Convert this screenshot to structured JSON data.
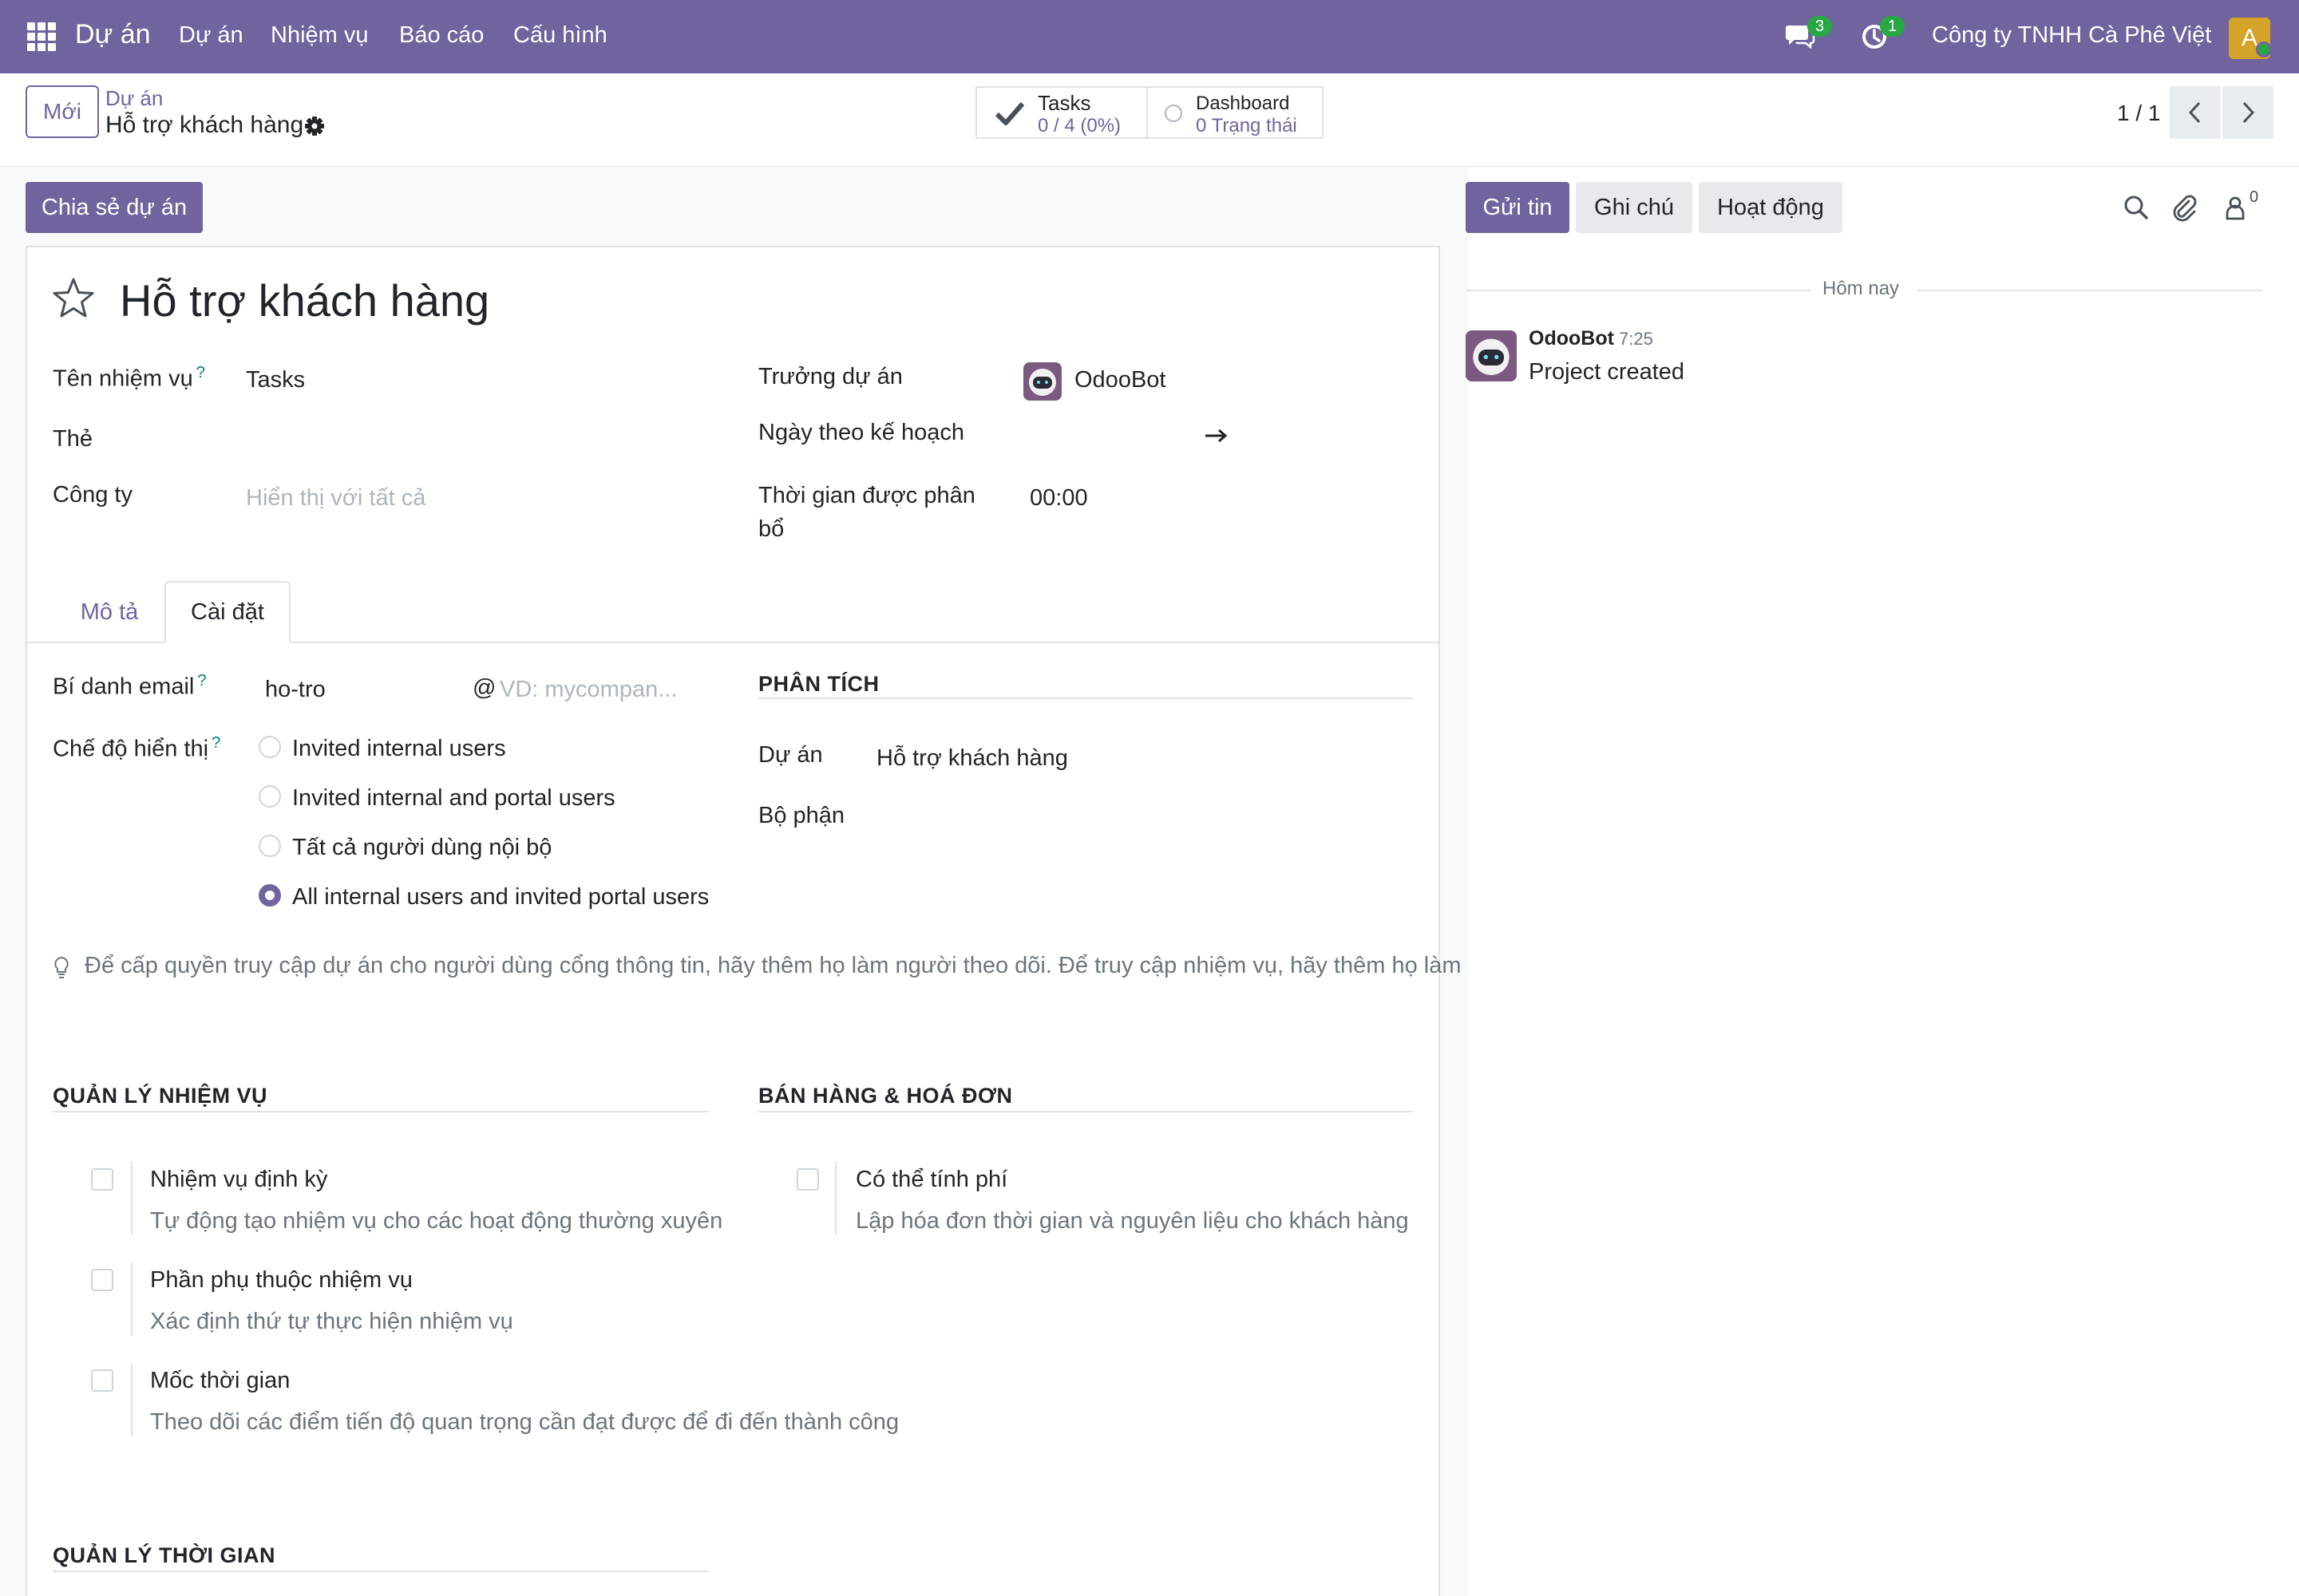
{
  "navbar": {
    "brand": "Dự án",
    "menu": [
      "Dự án",
      "Nhiệm vụ",
      "Báo cáo",
      "Cấu hình"
    ],
    "messages_count": "3",
    "activities_count": "1",
    "company": "Công ty TNHH Cà Phê Việt",
    "avatar_letter": "A"
  },
  "control": {
    "new_label": "Mới",
    "breadcrumb_parent": "Dự án",
    "breadcrumb_current": "Hỗ trợ khách hàng",
    "stats": {
      "tasks_title": "Tasks",
      "tasks_value": "0 / 4 (0%)",
      "dashboard_title": "Dashboard",
      "dashboard_value": "0 Trạng thái"
    },
    "pager": "1 / 1"
  },
  "form": {
    "share_label": "Chia sẻ dự án",
    "title": "Hỗ trợ khách hàng",
    "fields": {
      "task_name_label": "Tên nhiệm vụ",
      "task_name_value": "Tasks",
      "tags_label": "Thẻ",
      "company_label": "Công ty",
      "company_placeholder": "Hiển thị với tất cả",
      "manager_label": "Trưởng dự án",
      "manager_value": "OdooBot",
      "planned_date_label": "Ngày theo kế hoạch",
      "allocated_time_label": "Thời gian được phân bổ",
      "allocated_time_value": "00:00"
    },
    "tabs": [
      "Mô tả",
      "Cài đặt"
    ],
    "settings": {
      "email_alias_label": "Bí danh email",
      "email_alias_value": "ho-tro",
      "email_domain_placeholder": "VD: mycompan...",
      "visibility_label": "Chế độ hiển thị",
      "visibility_options": [
        "Invited internal users",
        "Invited internal and portal users",
        "Tất cả người dùng nội bộ",
        "All internal users and invited portal users"
      ],
      "visibility_selected": 3,
      "analytics_title": "PHÂN TÍCH",
      "project_label": "Dự án",
      "project_value": "Hỗ trợ khách hàng",
      "department_label": "Bộ phận",
      "hint": "Để cấp quyền truy cập dự án cho người dùng cổng thông tin, hãy thêm họ làm người theo dõi. Để truy cập nhiệm vụ, hãy thêm họ làm"
    },
    "task_management": {
      "title": "QUẢN LÝ NHIỆM VỤ",
      "items": [
        {
          "title": "Nhiệm vụ định kỳ",
          "desc": "Tự động tạo nhiệm vụ cho các hoạt động thường xuyên"
        },
        {
          "title": "Phần phụ thuộc nhiệm vụ",
          "desc": "Xác định thứ tự thực hiện nhiệm vụ"
        },
        {
          "title": "Mốc thời gian",
          "desc": "Theo dõi các điểm tiến độ quan trọng cần đạt được để đi đến thành công"
        }
      ]
    },
    "sales_invoicing": {
      "title": "BÁN HÀNG & HOÁ ĐƠN",
      "items": [
        {
          "title": "Có thể tính phí",
          "desc": "Lập hóa đơn thời gian và nguyên liệu cho khách hàng"
        }
      ]
    },
    "time_management": {
      "title": "QUẢN LÝ THỜI GIAN"
    }
  },
  "chatter": {
    "send_label": "Gửi tin",
    "note_label": "Ghi chú",
    "activity_label": "Hoạt động",
    "followers_count": "0",
    "day_separator": "Hôm nay",
    "message": {
      "author": "OdooBot",
      "time": "7:25",
      "body": "Project created"
    }
  },
  "colors": {
    "brand": "#71639e",
    "badge": "#28a745",
    "avatar": "#d4a42a"
  }
}
